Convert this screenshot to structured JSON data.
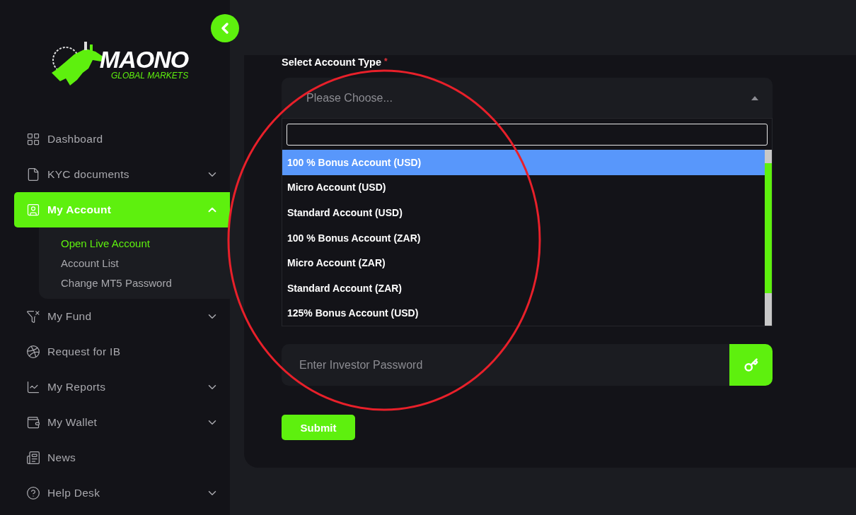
{
  "sidebar": {
    "logo": {
      "name": "MAONO",
      "tagline": "GLOBAL MARKETS"
    },
    "items": [
      {
        "label": "Dashboard",
        "kind": "link",
        "selected": false
      },
      {
        "label": "KYC documents",
        "kind": "group",
        "expanded": false,
        "selected": false
      },
      {
        "label": "My Account",
        "kind": "group",
        "expanded": true,
        "selected": true,
        "children": [
          {
            "label": "Open Live Account",
            "selected": true
          },
          {
            "label": "Account List",
            "selected": false
          },
          {
            "label": "Change MT5 Password",
            "selected": false
          }
        ]
      },
      {
        "label": "My Fund",
        "kind": "group",
        "expanded": false,
        "selected": false
      },
      {
        "label": "Request for IB",
        "kind": "link",
        "selected": false
      },
      {
        "label": "My Reports",
        "kind": "group",
        "expanded": false,
        "selected": false
      },
      {
        "label": "My Wallet",
        "kind": "group",
        "expanded": false,
        "selected": false
      },
      {
        "label": "News",
        "kind": "link",
        "selected": false
      },
      {
        "label": "Help Desk",
        "kind": "group",
        "expanded": false,
        "selected": false
      }
    ]
  },
  "form": {
    "account_type": {
      "label": "Select Account Type",
      "required_mark": "*",
      "placeholder": "Please Choose...",
      "open": true
    },
    "options": [
      {
        "label": "100 % Bonus Account (USD)",
        "selected": true
      },
      {
        "label": "Micro Account (USD)",
        "selected": false
      },
      {
        "label": "Standard Account (USD)",
        "selected": false
      },
      {
        "label": "100 % Bonus Account (ZAR)",
        "selected": false
      },
      {
        "label": "Micro Account (ZAR)",
        "selected": false
      },
      {
        "label": "Standard Account (ZAR)",
        "selected": false
      },
      {
        "label": "125% Bonus Account (USD)",
        "selected": false
      }
    ],
    "investor_password": {
      "placeholder": "Enter Investor Password"
    },
    "submit": "Submit"
  }
}
